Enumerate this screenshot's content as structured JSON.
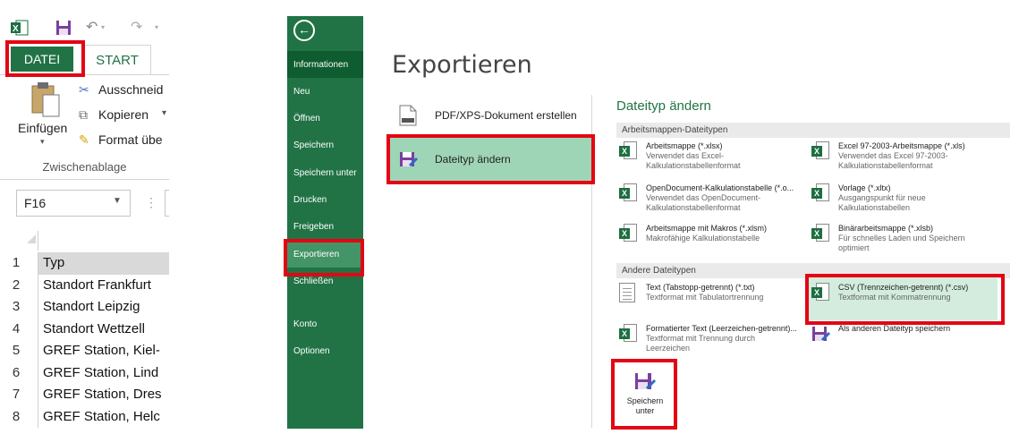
{
  "excel": {
    "tabs": {
      "file": "DATEI",
      "home": "START"
    },
    "clipboard": {
      "paste": "Einfügen",
      "cut": "Ausschneid",
      "copy": "Kopieren",
      "format_painter": "Format übe",
      "group_label": "Zwischenablage"
    },
    "name_box": "F16",
    "rows": [
      {
        "num": "1",
        "value": "Typ"
      },
      {
        "num": "2",
        "value": "Standort Frankfurt"
      },
      {
        "num": "3",
        "value": "Standort Leipzig"
      },
      {
        "num": "4",
        "value": "Standort Wettzell"
      },
      {
        "num": "5",
        "value": "GREF Station, Kiel-"
      },
      {
        "num": "6",
        "value": "GREF Station, Lind"
      },
      {
        "num": "7",
        "value": "GREF Station, Dres"
      },
      {
        "num": "8",
        "value": "GREF Station, Helc"
      }
    ]
  },
  "nav": {
    "items": [
      "Informationen",
      "Neu",
      "Öffnen",
      "Speichern",
      "Speichern unter",
      "Drucken",
      "Freigeben",
      "Exportieren",
      "Schließen",
      "Konto",
      "Optionen"
    ]
  },
  "export": {
    "title": "Exportieren",
    "options": [
      "PDF/XPS-Dokument erstellen",
      "Dateityp ändern"
    ]
  },
  "filetypes": {
    "title": "Dateityp ändern",
    "workbook_section": "Arbeitsmappen-Dateitypen",
    "other_section": "Andere Dateitypen",
    "workbook_types": [
      {
        "name": "Arbeitsmappe (*.xlsx)",
        "desc": [
          "Verwendet das Excel-",
          "Kalkulationstabellenformat"
        ]
      },
      {
        "name": "Excel 97-2003-Arbeitsmappe (*.xls)",
        "desc": [
          "Verwendet das Excel 97-2003-",
          "Kalkulationstabellenformat"
        ]
      },
      {
        "name": "OpenDocument-Kalkulationstabelle (*.o...",
        "desc": [
          "Verwendet das OpenDocument-",
          "Kalkulationstabellenformat"
        ]
      },
      {
        "name": "Vorlage (*.xltx)",
        "desc": [
          "Ausgangspunkt für neue",
          "Kalkulationstabellen"
        ]
      },
      {
        "name": "Arbeitsmappe mit Makros (*.xlsm)",
        "desc": [
          "Makrofähige Kalkulationstabelle"
        ]
      },
      {
        "name": "Binärarbeitsmappe (*.xlsb)",
        "desc": [
          "Für schnelles Laden und Speichern",
          "optimiert"
        ]
      }
    ],
    "other_types": [
      {
        "name": "Text (Tabstopp-getrennt) (*.txt)",
        "desc": [
          "Textformat mit Tabulatortrennung"
        ]
      },
      {
        "name": "CSV (Trennzeichen-getrennt) (*.csv)",
        "desc": [
          "Textformat mit Kommatrennung"
        ]
      },
      {
        "name": "Formatierter Text (Leerzeichen-getrennt)...",
        "desc": [
          "Textformat mit Trennung durch",
          "Leerzeichen"
        ]
      },
      {
        "name": "Als anderen Dateityp speichern",
        "desc": []
      }
    ],
    "save_as_button": [
      "Speichern",
      "unter"
    ]
  },
  "colors": {
    "excel_green": "#217346",
    "nav_selected": "#439467",
    "option_selected": "#9fd5b7",
    "csv_selected": "#d3ecdd",
    "highlight_red": "#e30613"
  }
}
